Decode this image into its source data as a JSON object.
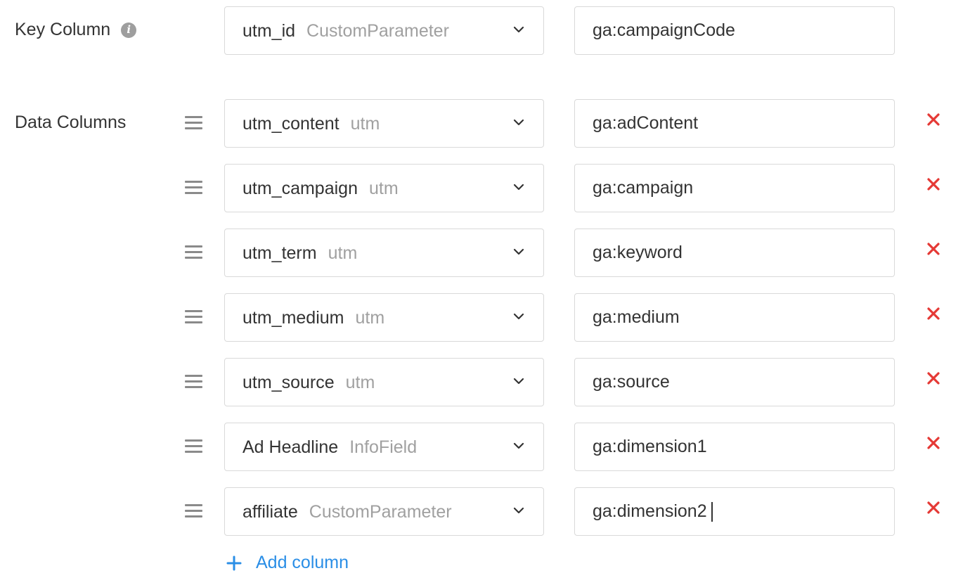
{
  "key_column": {
    "label": "Key Column",
    "info_icon": "info-icon",
    "select": {
      "name": "utm_id",
      "type": "CustomParameter"
    },
    "mapping": "ga:campaignCode"
  },
  "data_columns": {
    "label": "Data Columns",
    "rows": [
      {
        "select": {
          "name": "utm_content",
          "type": "utm"
        },
        "mapping": "ga:adContent"
      },
      {
        "select": {
          "name": "utm_campaign",
          "type": "utm"
        },
        "mapping": "ga:campaign"
      },
      {
        "select": {
          "name": "utm_term",
          "type": "utm"
        },
        "mapping": "ga:keyword"
      },
      {
        "select": {
          "name": "utm_medium",
          "type": "utm"
        },
        "mapping": "ga:medium"
      },
      {
        "select": {
          "name": "utm_source",
          "type": "utm"
        },
        "mapping": "ga:source"
      },
      {
        "select": {
          "name": "Ad Headline",
          "type": "InfoField"
        },
        "mapping": "ga:dimension1"
      },
      {
        "select": {
          "name": "affiliate",
          "type": "CustomParameter"
        },
        "mapping": "ga:dimension2"
      }
    ]
  },
  "add_column": {
    "label": "Add column",
    "icon": "plus-icon"
  },
  "colors": {
    "text": "#333333",
    "muted": "#a0a0a0",
    "border": "#d9d9d9",
    "remove": "#e53935",
    "link": "#2a8ee6"
  }
}
